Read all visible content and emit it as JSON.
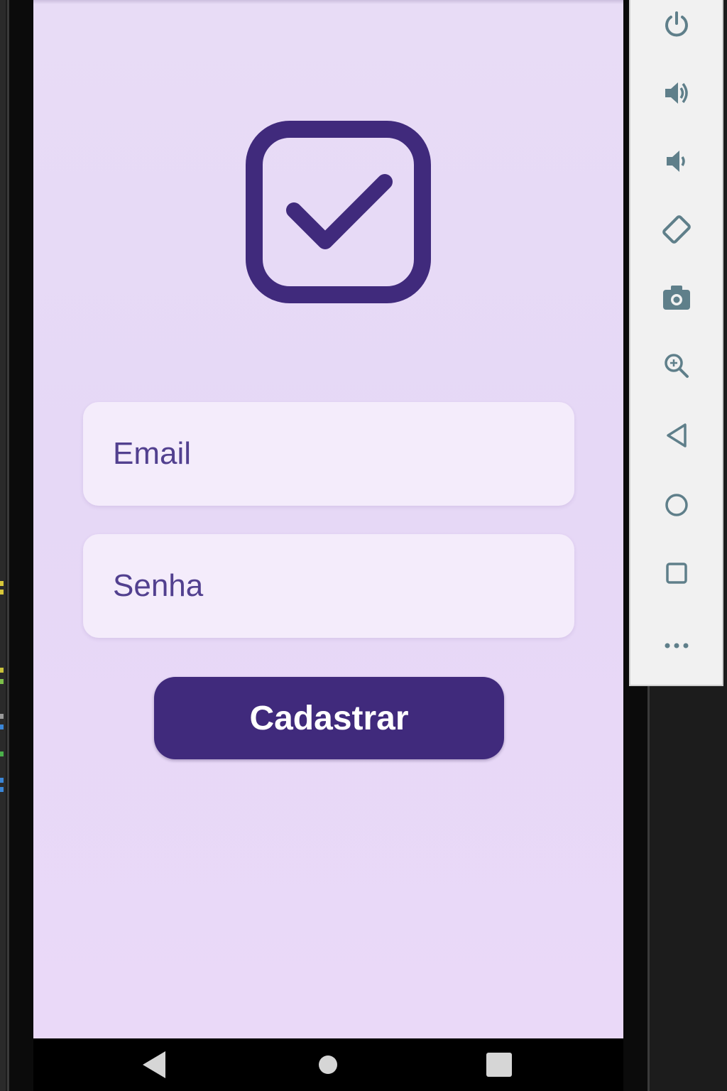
{
  "app": {
    "logo_icon": "checkbox-checked-icon",
    "accent_color": "#402a7c",
    "background_color": "#e8dcf6"
  },
  "form": {
    "email_placeholder": "Email",
    "password_placeholder": "Senha",
    "submit_label": "Cadastrar"
  },
  "system_nav": {
    "buttons": [
      "back-icon",
      "home-icon",
      "recents-icon"
    ]
  },
  "emulator_toolbar": {
    "tools": [
      "power-icon",
      "volume-up-icon",
      "volume-down-icon",
      "rotate-icon",
      "camera-icon",
      "zoom-icon",
      "back-icon",
      "home-icon",
      "overview-icon",
      "more-icon"
    ],
    "icon_color": "#5f7f8a"
  }
}
